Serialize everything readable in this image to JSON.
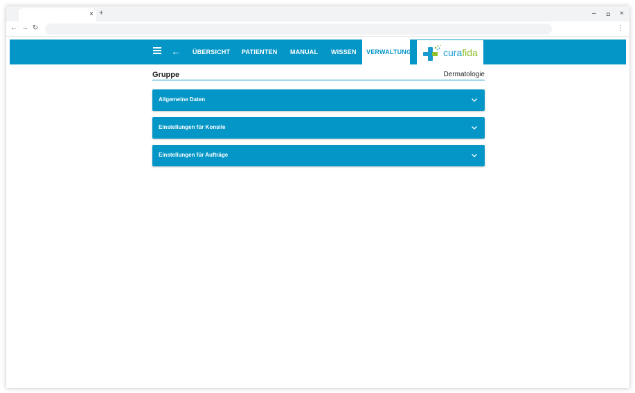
{
  "browser": {
    "tab_close": "×",
    "new_tab": "+",
    "window_controls": {
      "minimize": "–",
      "restore": "◘",
      "close": "×"
    },
    "nav": {
      "back": "←",
      "forward": "→",
      "reload": "↻"
    },
    "menu": "⋮",
    "address": ""
  },
  "app": {
    "back_glyph": "←",
    "nav": {
      "overview": "ÜBERSICHT",
      "patients": "PATIENTEN",
      "manual": "MANUAL",
      "knowledge": "WISSEN",
      "admin": "VERWALTUNG"
    },
    "logo": {
      "part1": "cura",
      "part2": "fida"
    },
    "colors": {
      "primary": "#0496c7",
      "logo_blue": "#1a9bd0",
      "logo_green": "#8dbf2e"
    }
  },
  "page": {
    "title": "Gruppe",
    "group_name": "Dermatologie",
    "panels": [
      {
        "label": "Allgemeine Daten"
      },
      {
        "label": "Einstellungen für Konsile"
      },
      {
        "label": "Einstellungen für Aufträge"
      }
    ]
  },
  "icons": {
    "menu": "hamburger-icon",
    "back": "arrow-left-icon",
    "panel_toggle": "chevron-down-icon",
    "logo": "cross-logo-icon"
  }
}
